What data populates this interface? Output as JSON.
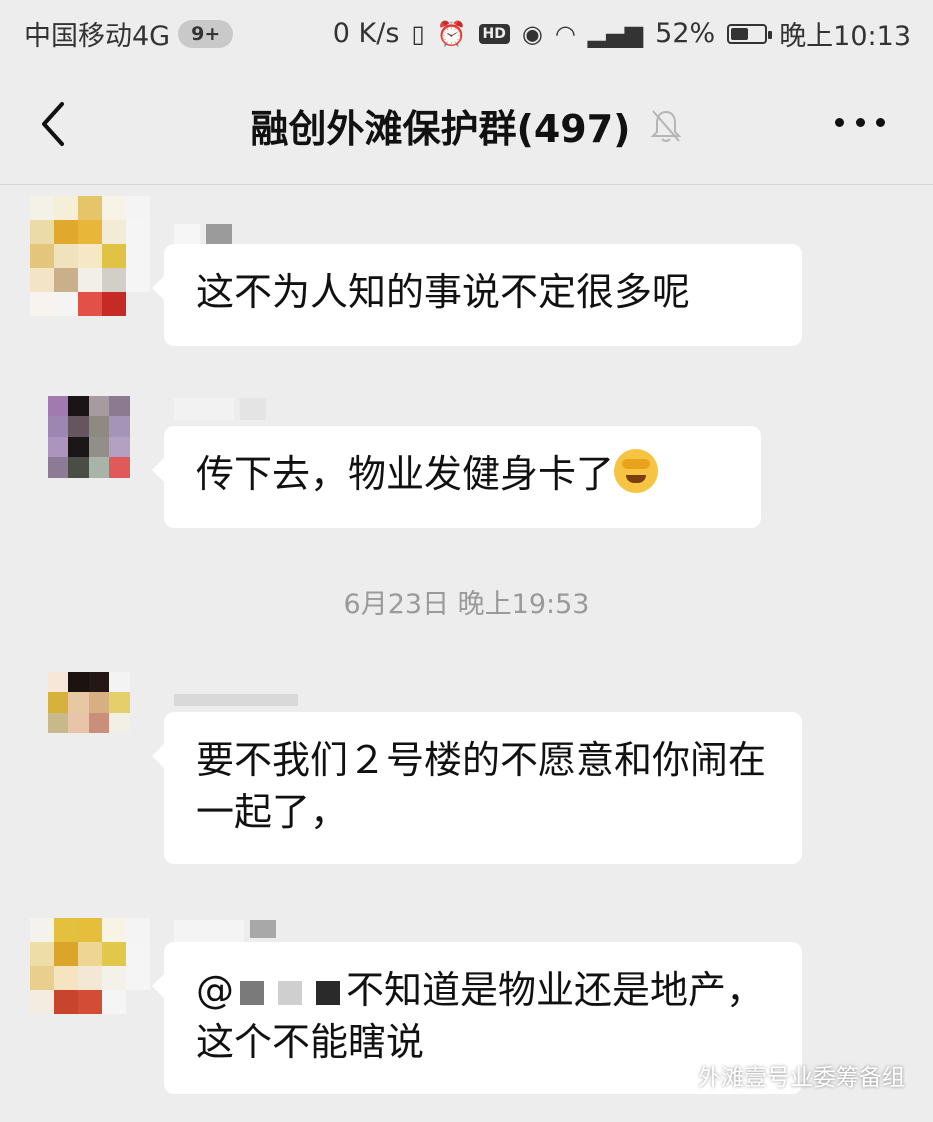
{
  "status_bar": {
    "carrier": "中国移动4G",
    "badge": "9+",
    "speed": "0 K/s",
    "battery_percent": "52%",
    "battery_level": 0.52,
    "time": "晚上10:13",
    "icons": [
      "vibrate-icon",
      "alarm-icon",
      "hd-icon",
      "eye-icon",
      "wifi-icon",
      "signal-4g-icon",
      "battery-icon"
    ]
  },
  "header": {
    "title": "融创外滩保护群(497)",
    "icons": [
      "back-icon",
      "mute-bell-icon",
      "more-icon"
    ]
  },
  "messages": [
    {
      "text": "这不为人知的事说不定很多呢"
    },
    {
      "text": "传下去，物业发健身卡了",
      "emoji": "crying-laughing-emoji"
    },
    {
      "text": "要不我们２号楼的不愿意和你闹在一起了，"
    },
    {
      "text_prefix": "@",
      "text": "不知道是物业还是地产，这个不能瞎说"
    }
  ],
  "timestamp": "6月23日 晚上19:53",
  "watermark": "外滩壹号业委筹备组",
  "colors": {
    "background": "#ededed",
    "bubble": "#ffffff",
    "timestamp": "#9a9a9a"
  }
}
